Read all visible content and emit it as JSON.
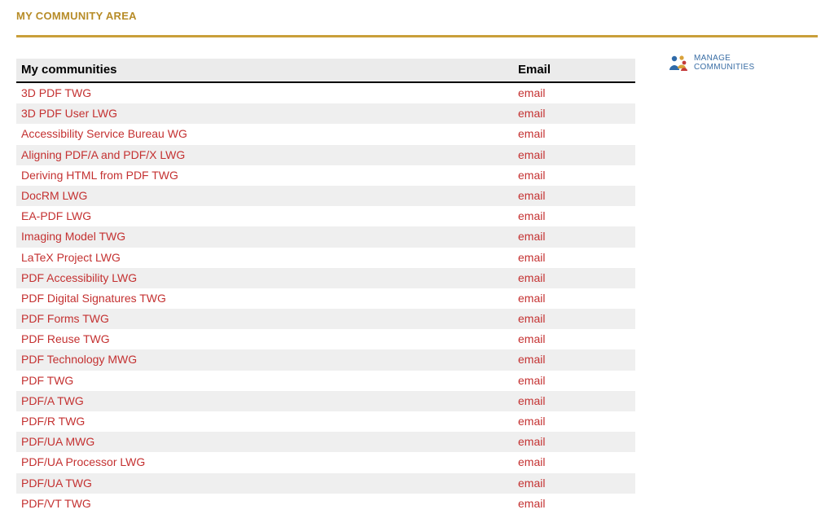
{
  "header": {
    "title": "MY COMMUNITY AREA"
  },
  "sidebar": {
    "manage_line1": "MANAGE",
    "manage_line2": "COMMUNITIES"
  },
  "table": {
    "col_name": "My communities",
    "col_email": "Email",
    "rows": [
      {
        "name": "3D PDF TWG",
        "email": "email"
      },
      {
        "name": "3D PDF User LWG",
        "email": "email"
      },
      {
        "name": "Accessibility Service Bureau WG",
        "email": "email"
      },
      {
        "name": "Aligning PDF/A and PDF/X LWG",
        "email": "email"
      },
      {
        "name": "Deriving HTML from PDF TWG",
        "email": "email"
      },
      {
        "name": "DocRM LWG",
        "email": "email"
      },
      {
        "name": "EA-PDF LWG",
        "email": "email"
      },
      {
        "name": "Imaging Model TWG",
        "email": "email"
      },
      {
        "name": "LaTeX Project LWG",
        "email": "email"
      },
      {
        "name": "PDF Accessibility LWG",
        "email": "email"
      },
      {
        "name": "PDF Digital Signatures TWG",
        "email": "email"
      },
      {
        "name": "PDF Forms TWG",
        "email": "email"
      },
      {
        "name": "PDF Reuse TWG",
        "email": "email"
      },
      {
        "name": "PDF Technology MWG",
        "email": "email"
      },
      {
        "name": "PDF TWG",
        "email": "email"
      },
      {
        "name": "PDF/A TWG",
        "email": "email"
      },
      {
        "name": "PDF/R TWG",
        "email": "email"
      },
      {
        "name": "PDF/UA MWG",
        "email": "email"
      },
      {
        "name": "PDF/UA Processor LWG",
        "email": "email"
      },
      {
        "name": "PDF/UA TWG",
        "email": "email"
      },
      {
        "name": "PDF/VT TWG",
        "email": "email"
      }
    ]
  }
}
